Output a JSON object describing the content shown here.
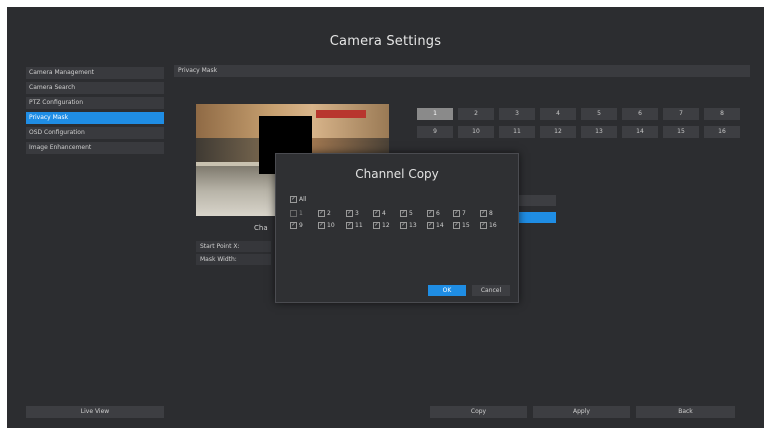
{
  "window": {
    "title": "Camera Settings"
  },
  "sidebar": {
    "items": [
      {
        "label": "Camera Management",
        "active": false
      },
      {
        "label": "Camera Search",
        "active": false
      },
      {
        "label": "PTZ Configuration",
        "active": false
      },
      {
        "label": "Privacy Mask",
        "active": true
      },
      {
        "label": "OSD Configuration",
        "active": false
      },
      {
        "label": "Image Enhancement",
        "active": false
      }
    ]
  },
  "section": {
    "title": "Privacy Mask"
  },
  "preview": {
    "label": "Cha"
  },
  "channels": {
    "row1": [
      "1",
      "2",
      "3",
      "4",
      "5",
      "6",
      "7",
      "8"
    ],
    "row2": [
      "9",
      "10",
      "11",
      "12",
      "13",
      "14",
      "15",
      "16"
    ],
    "selected": "1"
  },
  "fields": {
    "start_point_x": "Start Point X:",
    "mask_width": "Mask Width:"
  },
  "dialog": {
    "title": "Channel Copy",
    "all_label": "All",
    "channels": [
      "1",
      "2",
      "3",
      "4",
      "5",
      "6",
      "7",
      "8",
      "9",
      "10",
      "11",
      "12",
      "13",
      "14",
      "15",
      "16"
    ],
    "ok_label": "OK",
    "cancel_label": "Cancel"
  },
  "footer": {
    "live_view": "Live View",
    "copy": "Copy",
    "apply": "Apply",
    "back": "Back"
  },
  "colors": {
    "accent": "#1f8de4",
    "background": "#2c2d30"
  }
}
